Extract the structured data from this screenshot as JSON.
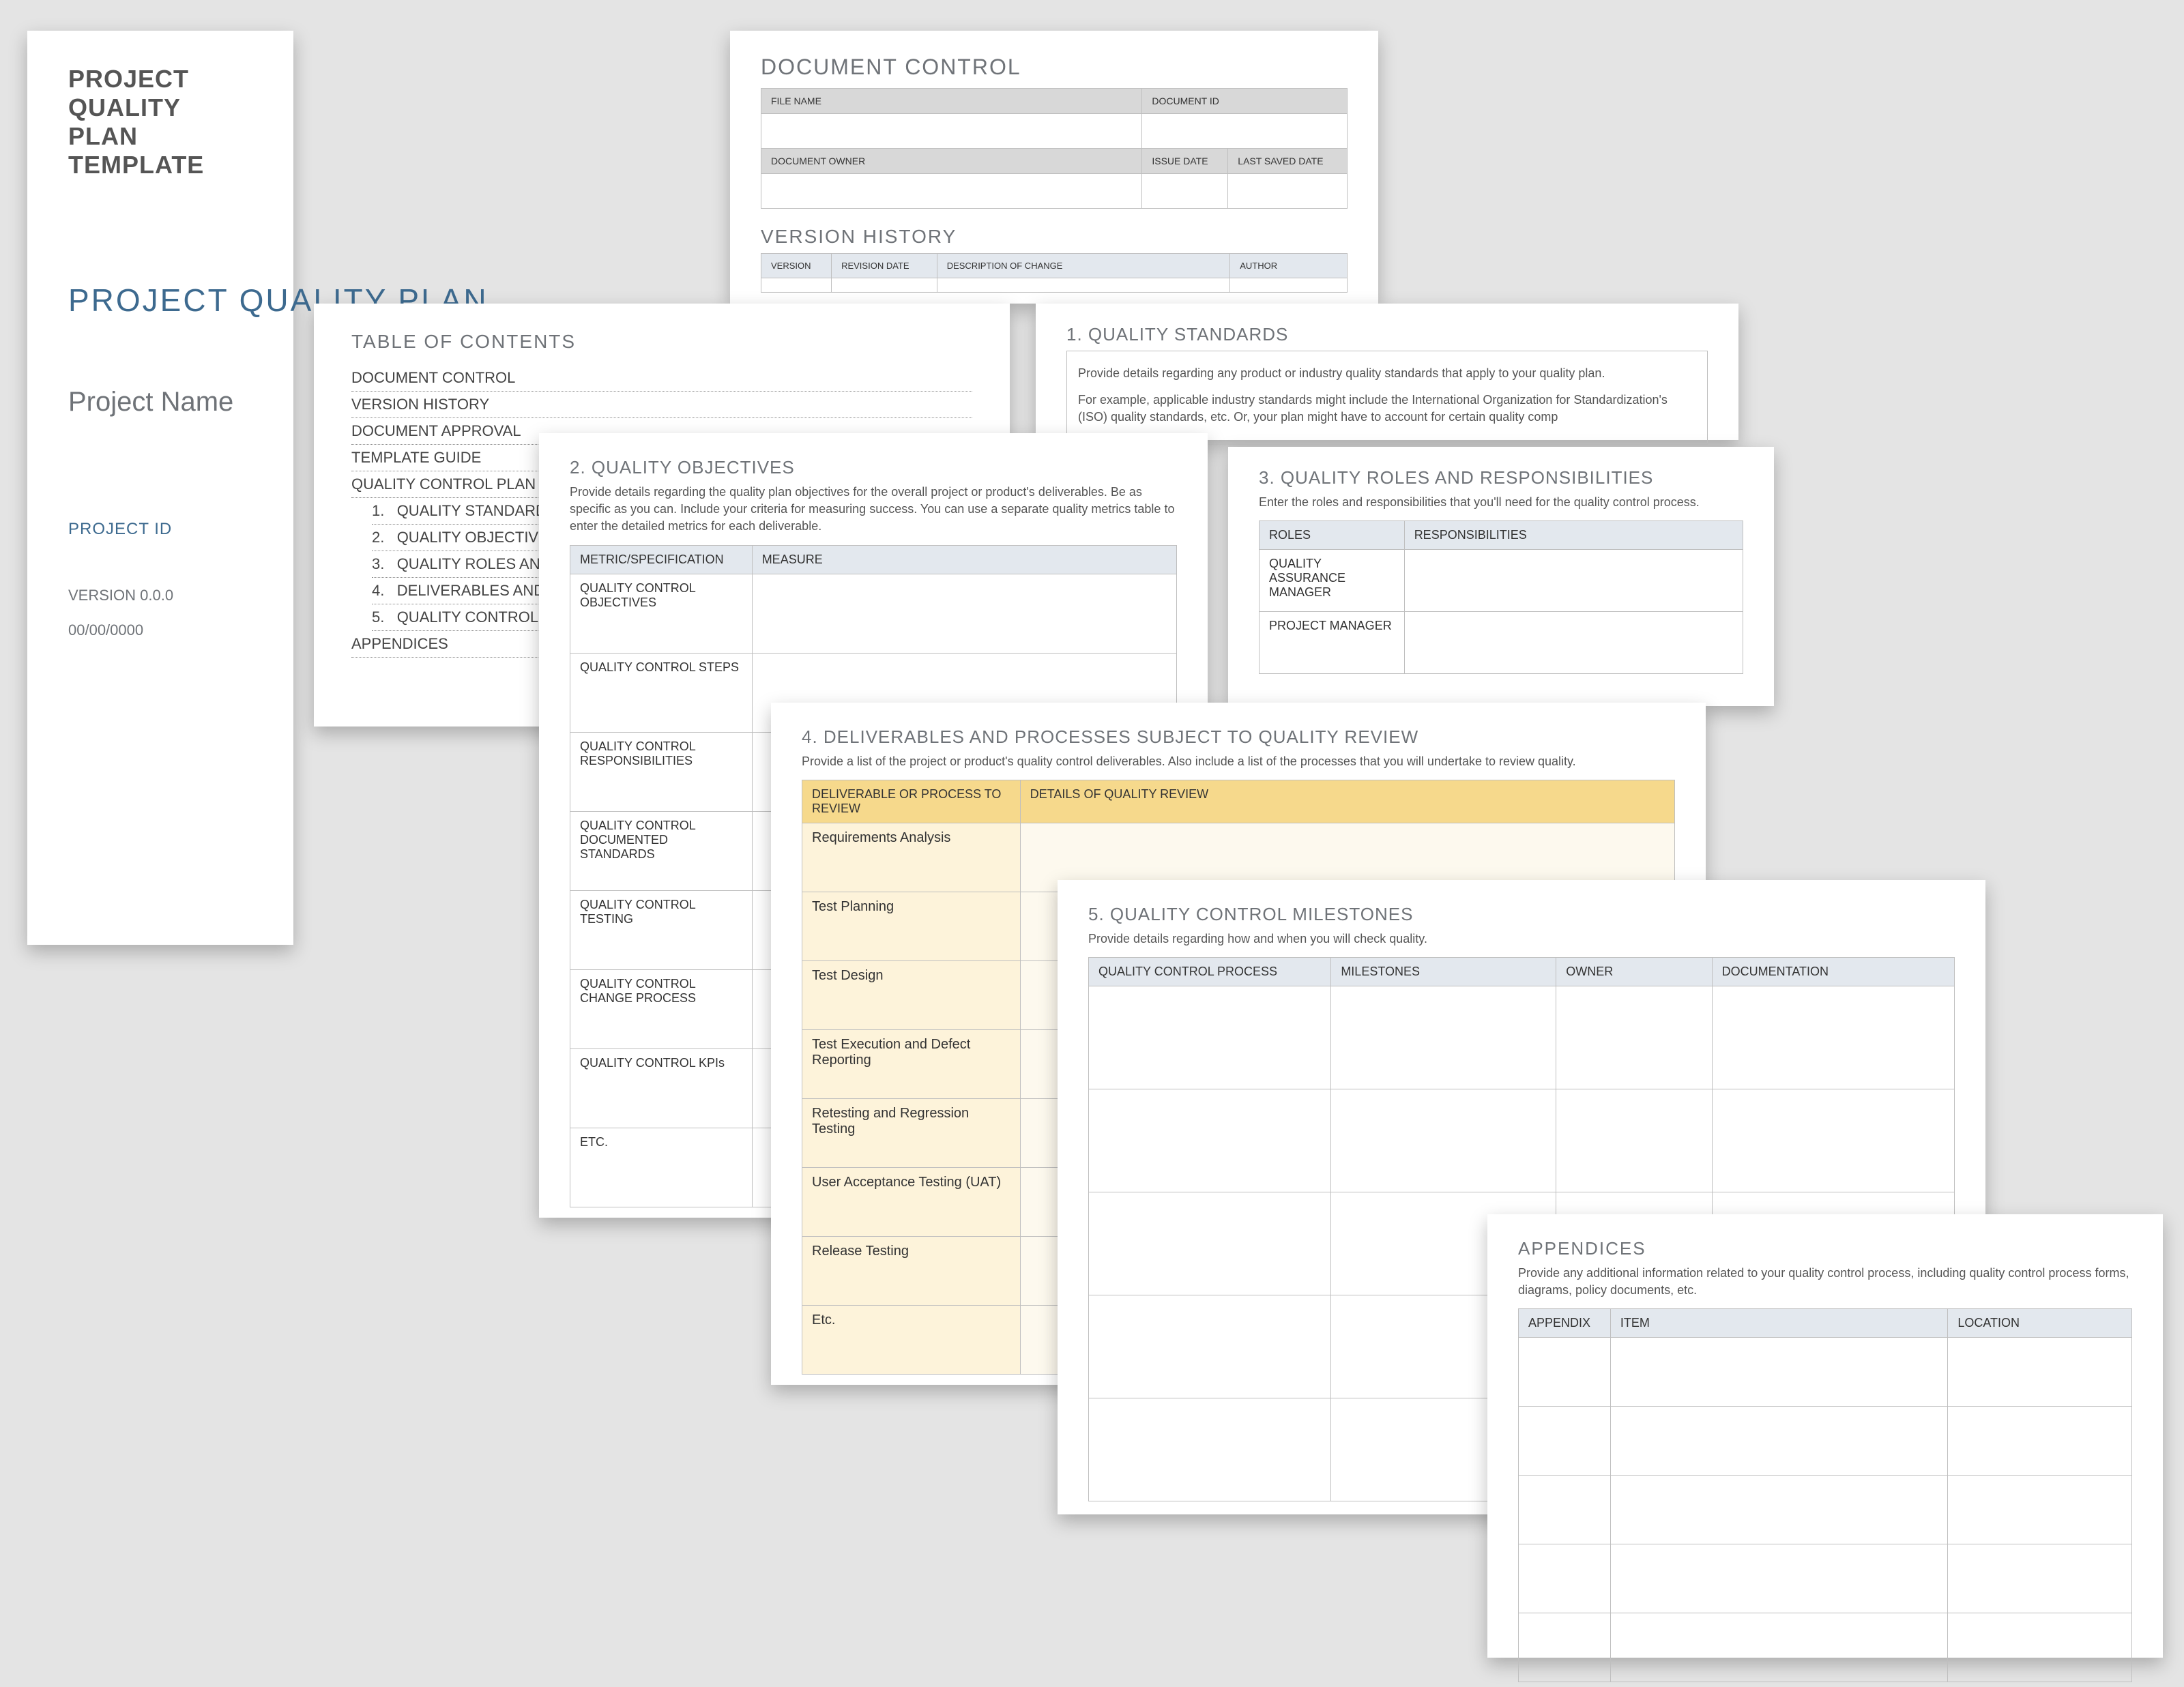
{
  "cover": {
    "title1": "PROJECT QUALITY",
    "title2": "PLAN TEMPLATE",
    "main": "PROJECT QUALITY PLAN",
    "projectName": "Project Name",
    "projectIdLabel": "PROJECT ID",
    "version": "VERSION 0.0.0",
    "date": "00/00/0000"
  },
  "docControl": {
    "heading": "DOCUMENT CONTROL",
    "headers": {
      "fileName": "FILE NAME",
      "documentId": "DOCUMENT ID",
      "documentOwner": "DOCUMENT OWNER",
      "issueDate": "ISSUE DATE",
      "lastSaved": "LAST SAVED DATE"
    }
  },
  "versionHistory": {
    "heading": "VERSION HISTORY",
    "headers": {
      "version": "VERSION",
      "revisionDate": "REVISION DATE",
      "description": "DESCRIPTION OF CHANGE",
      "author": "AUTHOR"
    }
  },
  "toc": {
    "heading": "TABLE OF CONTENTS",
    "linesTop": [
      "DOCUMENT CONTROL",
      "VERSION HISTORY",
      "DOCUMENT APPROVAL",
      "TEMPLATE GUIDE",
      "QUALITY CONTROL PLAN"
    ],
    "numbered": [
      "QUALITY STANDARDS",
      "QUALITY OBJECTIVES",
      "QUALITY ROLES AND",
      "DELIVERABLES AND",
      "QUALITY CONTROL"
    ],
    "bottom": "APPENDICES"
  },
  "standards": {
    "heading": "1.  QUALITY STANDARDS",
    "body1": "Provide details regarding any product or industry quality standards that apply to your quality plan.",
    "body2": "For example, applicable industry standards might include the International Organization for Standardization's (ISO) quality standards, etc. Or, your plan might have to account for certain quality comp"
  },
  "objectives": {
    "heading": "2.  QUALITY OBJECTIVES",
    "body": "Provide details regarding the quality plan objectives for the overall project or product's deliverables. Be as specific as you can. Include your criteria for measuring success. You can use a separate quality metrics table to enter the detailed metrics for each deliverable.",
    "headers": {
      "c1": "METRIC/SPECIFICATION",
      "c2": "MEASURE"
    },
    "rows": [
      "QUALITY CONTROL OBJECTIVES",
      "QUALITY CONTROL STEPS",
      "QUALITY CONTROL RESPONSIBILITIES",
      "QUALITY CONTROL DOCUMENTED STANDARDS",
      "QUALITY CONTROL TESTING",
      "QUALITY CONTROL CHANGE PROCESS",
      "QUALITY CONTROL KPIs",
      "ETC."
    ]
  },
  "roles": {
    "heading": "3.  QUALITY ROLES AND RESPONSIBILITIES",
    "body": "Enter the roles and responsibilities that you'll need for the quality control process.",
    "headers": {
      "c1": "ROLES",
      "c2": "RESPONSIBILITIES"
    },
    "rows": [
      "QUALITY ASSURANCE MANAGER",
      "PROJECT MANAGER"
    ]
  },
  "deliverables": {
    "heading": "4.   DELIVERABLES AND PROCESSES SUBJECT TO QUALITY REVIEW",
    "body": "Provide a list of the project or product's quality control deliverables. Also include a list of the processes that you will undertake to review quality.",
    "headers": {
      "c1": "DELIVERABLE OR PROCESS TO REVIEW",
      "c2": "DETAILS OF QUALITY REVIEW"
    },
    "rows": [
      "Requirements Analysis",
      "Test Planning",
      "Test Design",
      "Test Execution and Defect Reporting",
      "Retesting and Regression Testing",
      "User Acceptance Testing (UAT)",
      "Release Testing",
      "Etc."
    ]
  },
  "milestones": {
    "heading": "5.  QUALITY CONTROL MILESTONES",
    "body": "Provide details regarding how and when you will check quality.",
    "headers": {
      "c1": "QUALITY CONTROL PROCESS",
      "c2": "MILESTONES",
      "c3": "OWNER",
      "c4": "DOCUMENTATION"
    }
  },
  "appendices": {
    "heading": "APPENDICES",
    "body": "Provide any additional information related to your quality control process, including quality control process forms, diagrams, policy documents, etc.",
    "headers": {
      "c1": "APPENDIX",
      "c2": "ITEM",
      "c3": "LOCATION"
    }
  }
}
